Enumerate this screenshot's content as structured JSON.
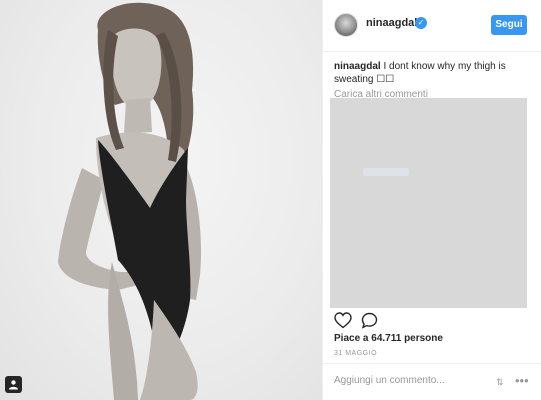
{
  "post": {
    "username": "ninaagdal",
    "follow_label": "Segui",
    "caption_user": "ninaagdal",
    "caption_text": " I dont know why my thigh is sweating ☐☐",
    "load_more": "Carica altri commenti",
    "likes": "Piace a 64.711 persone",
    "date": "31 MAGGIO",
    "comment_placeholder": "Aggiungi un commento...",
    "verified_glyph": "✓",
    "scroll_glyph": "⇅",
    "more_glyph": "•••"
  },
  "icons": {
    "like": "heart-icon",
    "comment": "comment-icon",
    "tag": "person-tag-icon",
    "verified": "verified-badge-icon",
    "more": "more-options-icon"
  },
  "colors": {
    "accent": "#3897f0",
    "text": "#262626",
    "muted": "#999999",
    "overlay": "#d8d8d8"
  }
}
